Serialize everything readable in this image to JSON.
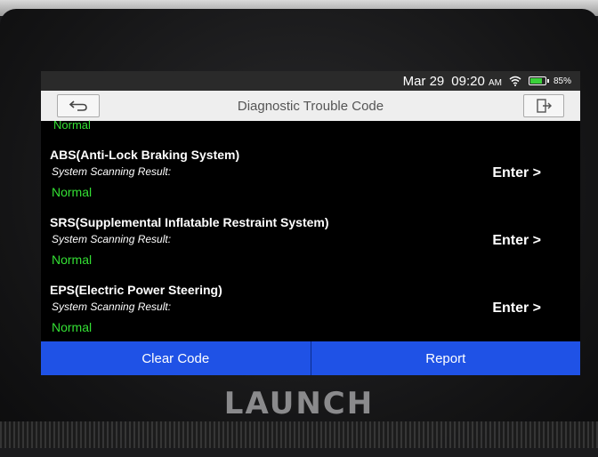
{
  "status_bar": {
    "date": "Mar 29",
    "time": "09:20",
    "ampm": "AM",
    "battery": "85%"
  },
  "header": {
    "title": "Diagnostic Trouble Code",
    "back_icon": "back-arrow-icon",
    "exit_icon": "exit-icon"
  },
  "list": {
    "partial_top_status": "Normal",
    "systems": [
      {
        "name": "ABS(Anti-Lock Braking System)",
        "scan_label": "System Scanning Result:",
        "status": "Normal",
        "action": "Enter >"
      },
      {
        "name": "SRS(Supplemental Inflatable Restraint System)",
        "scan_label": "System Scanning Result:",
        "status": "Normal",
        "action": "Enter >"
      },
      {
        "name": "EPS(Electric Power Steering)",
        "scan_label": "System Scanning Result:",
        "status": "Normal",
        "action": "Enter >"
      }
    ]
  },
  "actions": {
    "clear_code": "Clear Code",
    "report": "Report"
  },
  "brand": "LAUNCH",
  "colors": {
    "status_ok": "#34e034",
    "button_blue": "#1f52e6",
    "title_bar_bg": "#eeeeee"
  }
}
